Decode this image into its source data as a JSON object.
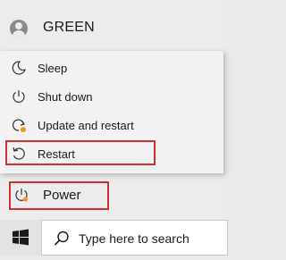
{
  "user": {
    "name": "GREEN"
  },
  "power_menu": {
    "items": [
      {
        "label": "Sleep",
        "icon": "moon-icon"
      },
      {
        "label": "Shut down",
        "icon": "power-icon"
      },
      {
        "label": "Update and restart",
        "icon": "update-restart-icon"
      },
      {
        "label": "Restart",
        "icon": "restart-icon"
      }
    ]
  },
  "power_button": {
    "label": "Power",
    "icon": "power-icon"
  },
  "taskbar": {
    "start_icon": "windows-logo-icon",
    "search": {
      "placeholder": "Type here to search",
      "icon": "search-icon"
    }
  },
  "colors": {
    "highlight": "#d32f2f",
    "update_badge": "#f7941d",
    "panel_bg": "#ececec",
    "menu_bg": "#f2f2f2"
  }
}
